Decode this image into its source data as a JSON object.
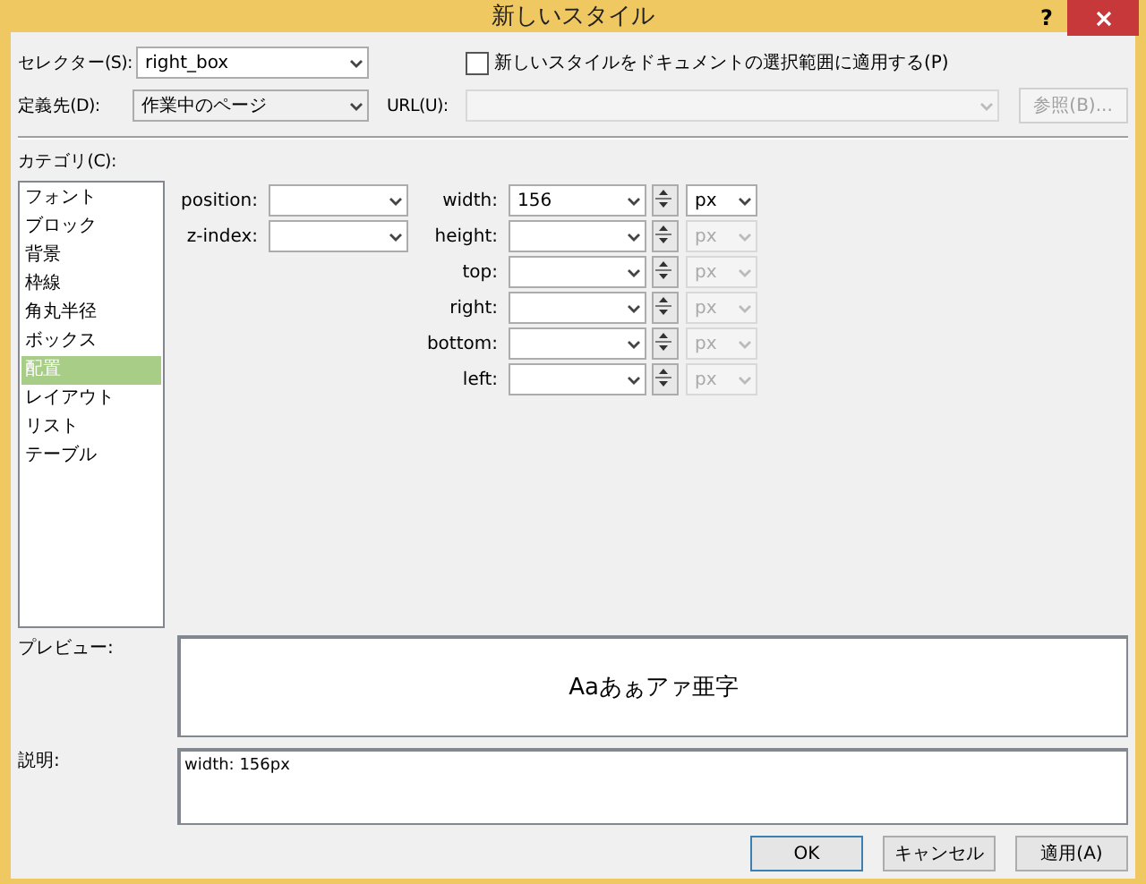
{
  "window": {
    "title": "新しいスタイル",
    "help": "?"
  },
  "selector": {
    "label": "セレクター(S):",
    "value": "right_box"
  },
  "apply_checkbox": {
    "label": "新しいスタイルをドキュメントの選択範囲に適用する(P)",
    "checked": false
  },
  "defined_in": {
    "label": "定義先(D):",
    "value": "作業中のページ"
  },
  "url": {
    "label": "URL(U):",
    "disabled": true
  },
  "browse_button": {
    "label": "参照(B)...",
    "disabled": true
  },
  "category": {
    "label": "カテゴリ(C):",
    "items": [
      {
        "label": "フォント",
        "selected": false
      },
      {
        "label": "ブロック",
        "selected": false
      },
      {
        "label": "背景",
        "selected": false
      },
      {
        "label": "枠線",
        "selected": false
      },
      {
        "label": "角丸半径",
        "selected": false
      },
      {
        "label": "ボックス",
        "selected": false
      },
      {
        "label": "配置",
        "selected": true
      },
      {
        "label": "レイアウト",
        "selected": false
      },
      {
        "label": "リスト",
        "selected": false
      },
      {
        "label": "テーブル",
        "selected": false
      }
    ]
  },
  "left_fields": [
    {
      "label": "position:"
    },
    {
      "label": "z-index:"
    }
  ],
  "size_fields": [
    {
      "label": "width:",
      "value": "156",
      "unit": "px",
      "unit_disabled": false
    },
    {
      "label": "height:",
      "unit": "px",
      "unit_disabled": true
    },
    {
      "label": "top:",
      "unit": "px",
      "unit_disabled": true
    },
    {
      "label": "right:",
      "unit": "px",
      "unit_disabled": true
    },
    {
      "label": "bottom:",
      "unit": "px",
      "unit_disabled": true
    },
    {
      "label": "left:",
      "unit": "px",
      "unit_disabled": true
    }
  ],
  "preview": {
    "label": "プレビュー:",
    "sample": "Aaあぁアァ亜字"
  },
  "description": {
    "label": "説明:",
    "text": "width: 156px"
  },
  "buttons": [
    {
      "label": "OK",
      "default": true
    },
    {
      "label": "キャンセル",
      "default": false
    },
    {
      "label": "適用(A)",
      "default": false
    }
  ]
}
